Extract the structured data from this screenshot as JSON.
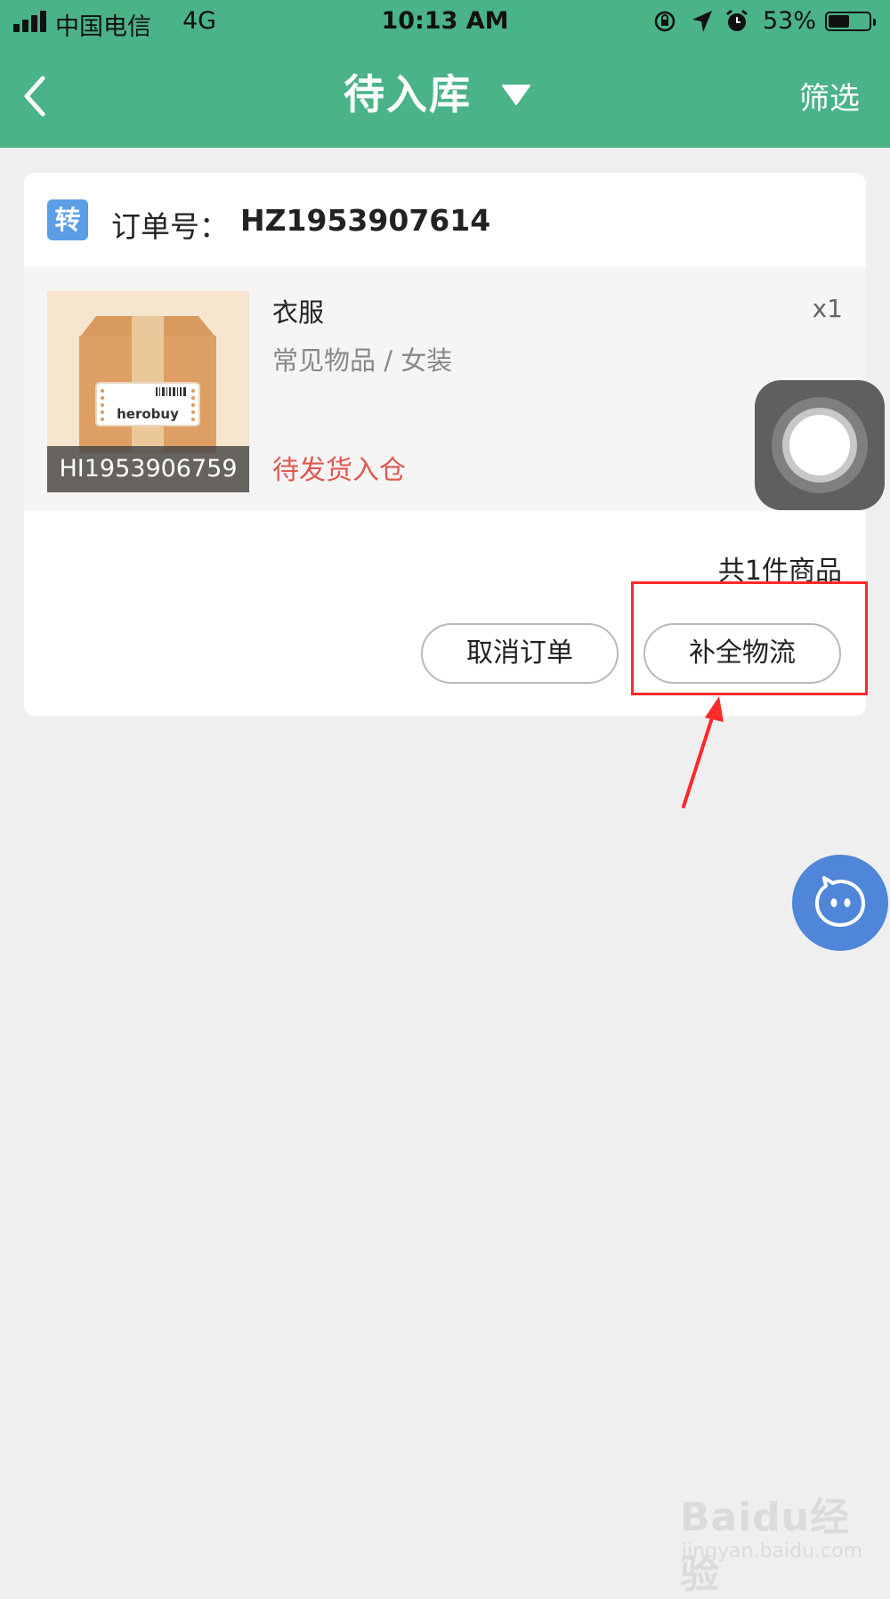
{
  "status_bar": {
    "carrier": "中国电信",
    "network": "4G",
    "time": "10:13 AM",
    "battery_percent": "53%",
    "battery_level": 0.53,
    "icons": [
      "signal-icon",
      "orientation-lock-icon",
      "location-icon",
      "alarm-icon",
      "battery-icon"
    ]
  },
  "nav": {
    "title": "待入库",
    "filter_label": "筛选",
    "icons": [
      "back-chevron-icon",
      "dropdown-triangle-icon"
    ]
  },
  "order": {
    "tag": "转",
    "order_label": "订单号：",
    "order_number": "HZ1953907614",
    "item": {
      "name": "衣服",
      "category": "常见物品 / 女装",
      "quantity": "x1",
      "code": "HI1953906759",
      "status": "待发货入仓",
      "thumbnail_label": "herobuy"
    },
    "summary": "共1件商品",
    "buttons": {
      "cancel": "取消订单",
      "complete_logistics": "补全物流"
    }
  },
  "colors": {
    "header": "#4ab387",
    "tag": "#5b9ee6",
    "status_text": "#e0584f",
    "annotation": "#ff2a2a",
    "service_button": "#4f86d9"
  },
  "watermark": {
    "logo": "Baidu经验",
    "site": "jingyan.baidu.com"
  }
}
